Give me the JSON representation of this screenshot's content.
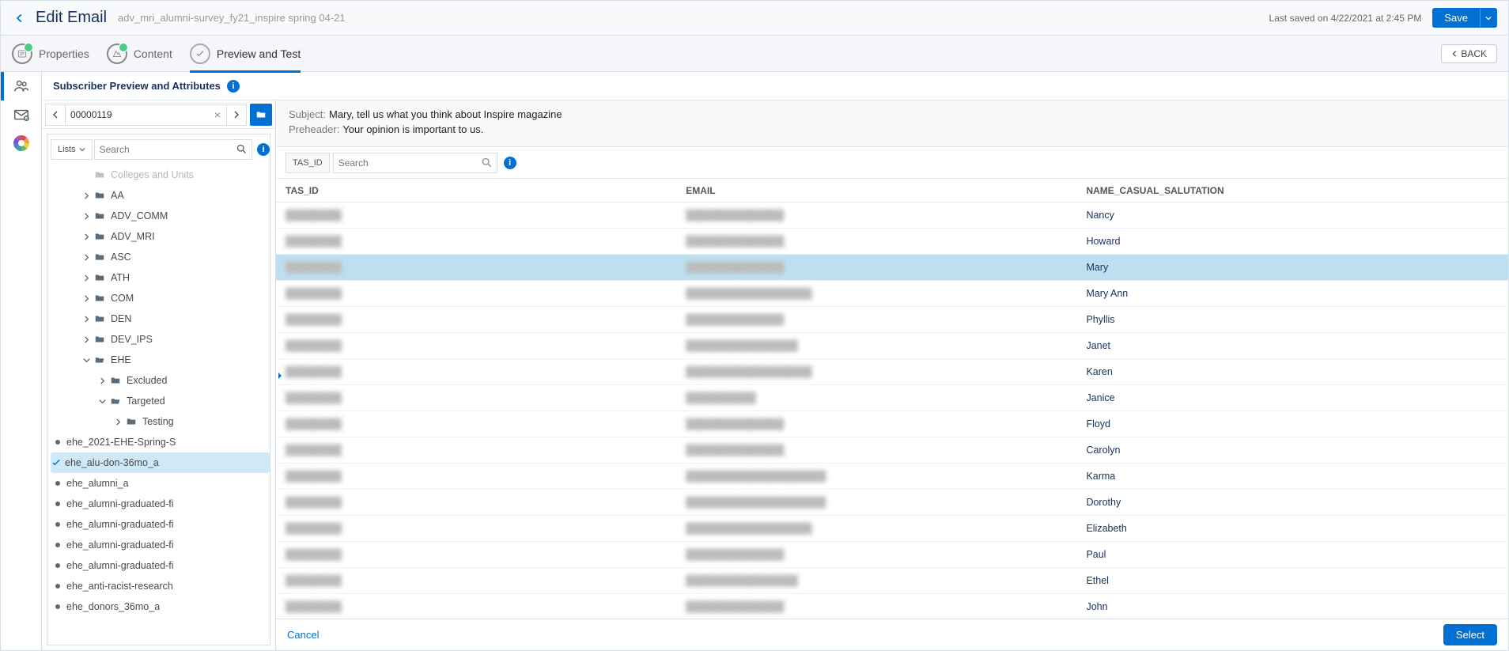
{
  "header": {
    "title": "Edit Email",
    "subtitle": "adv_mri_alumni-survey_fy21_inspire spring 04-21",
    "last_saved": "Last saved on 4/22/2021 at 2:45 PM",
    "save_label": "Save"
  },
  "tabs": {
    "properties": "Properties",
    "content": "Content",
    "preview": "Preview and Test",
    "back_label": "BACK"
  },
  "panel": {
    "title": "Subscriber Preview and Attributes"
  },
  "nav": {
    "subscriber_id": "00000119"
  },
  "tree_search": {
    "lists_label": "Lists",
    "placeholder": "Search"
  },
  "tree": {
    "top_faded": "Colleges and Units",
    "aa": "AA",
    "adv_comm": "ADV_COMM",
    "adv_mri": "ADV_MRI",
    "asc": "ASC",
    "ath": "ATH",
    "com": "COM",
    "den": "DEN",
    "dev_ips": "DEV_IPS",
    "ehe": "EHE",
    "excluded": "Excluded",
    "targeted": "Targeted",
    "testing": "Testing",
    "leaf1": "ehe_2021-EHE-Spring-S",
    "leaf2": "ehe_alu-don-36mo_a",
    "leaf3": "ehe_alumni_a",
    "leaf4": "ehe_alumni-graduated-fi",
    "leaf5": "ehe_alumni-graduated-fi",
    "leaf6": "ehe_alumni-graduated-fi",
    "leaf7": "ehe_alumni-graduated-fi",
    "leaf8": "ehe_anti-racist-research",
    "leaf9": "ehe_donors_36mo_a"
  },
  "meta": {
    "subject_label": "Subject:",
    "subject_value": "Mary, tell us what you think about Inspire magazine",
    "preheader_label": "Preheader:",
    "preheader_value": "Your opinion is important to us."
  },
  "content_search": {
    "tasid_label": "TAS_ID",
    "placeholder": "Search"
  },
  "columns": {
    "id": "TAS_ID",
    "email": "EMAIL",
    "name": "NAME_CASUAL_SALUTATION"
  },
  "rows": [
    {
      "id": "████████",
      "email": "██████████████",
      "name": "Nancy",
      "selected": false
    },
    {
      "id": "████████",
      "email": "██████████████",
      "name": "Howard",
      "selected": false
    },
    {
      "id": "████████",
      "email": "██████████████",
      "name": "Mary",
      "selected": true
    },
    {
      "id": "████████",
      "email": "██████████████████",
      "name": "Mary Ann",
      "selected": false
    },
    {
      "id": "████████",
      "email": "██████████████",
      "name": "Phyllis",
      "selected": false
    },
    {
      "id": "████████",
      "email": "████████████████",
      "name": "Janet",
      "selected": false
    },
    {
      "id": "████████",
      "email": "██████████████████",
      "name": "Karen",
      "selected": false
    },
    {
      "id": "████████",
      "email": "██████████",
      "name": "Janice",
      "selected": false
    },
    {
      "id": "████████",
      "email": "██████████████",
      "name": "Floyd",
      "selected": false
    },
    {
      "id": "████████",
      "email": "██████████████",
      "name": "Carolyn",
      "selected": false
    },
    {
      "id": "████████",
      "email": "████████████████████",
      "name": "Karma",
      "selected": false
    },
    {
      "id": "████████",
      "email": "████████████████████",
      "name": "Dorothy",
      "selected": false
    },
    {
      "id": "████████",
      "email": "██████████████████",
      "name": "Elizabeth",
      "selected": false
    },
    {
      "id": "████████",
      "email": "██████████████",
      "name": "Paul",
      "selected": false
    },
    {
      "id": "████████",
      "email": "████████████████",
      "name": "Ethel",
      "selected": false
    },
    {
      "id": "████████",
      "email": "██████████████",
      "name": "John",
      "selected": false
    }
  ],
  "footer": {
    "cancel": "Cancel",
    "select": "Select"
  }
}
